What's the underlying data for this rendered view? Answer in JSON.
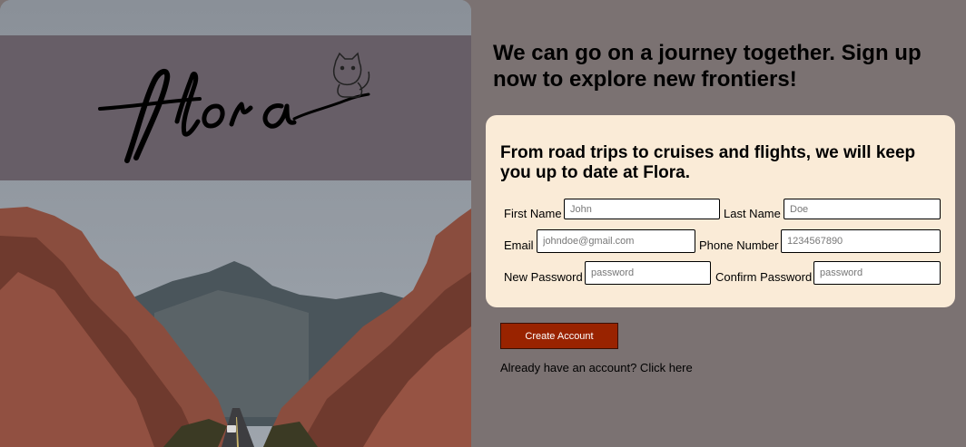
{
  "brand": {
    "logo_text": "flora"
  },
  "headline": "We can go on a journey together. Sign up now to explore new frontiers!",
  "card": {
    "title": "From road trips to cruises and flights, we will keep you up to date at Flora."
  },
  "form": {
    "first_name": {
      "label": "First Name",
      "placeholder": "John",
      "value": ""
    },
    "last_name": {
      "label": "Last Name",
      "placeholder": "Doe",
      "value": ""
    },
    "email": {
      "label": "Email",
      "placeholder": "johndoe@gmail.com",
      "value": ""
    },
    "phone": {
      "label": "Phone Number",
      "placeholder": "1234567890",
      "value": ""
    },
    "new_password": {
      "label": "New Password",
      "placeholder": "password",
      "value": ""
    },
    "confirm_password": {
      "label": "Confirm Password",
      "placeholder": "password",
      "value": ""
    }
  },
  "actions": {
    "create_account": "Create Account",
    "sign_in_link": "Already have an account? Click here"
  },
  "colors": {
    "page_bg": "#7b7272",
    "card_bg": "#faebd7",
    "logo_band": "#675e67",
    "cta": "#992300"
  }
}
